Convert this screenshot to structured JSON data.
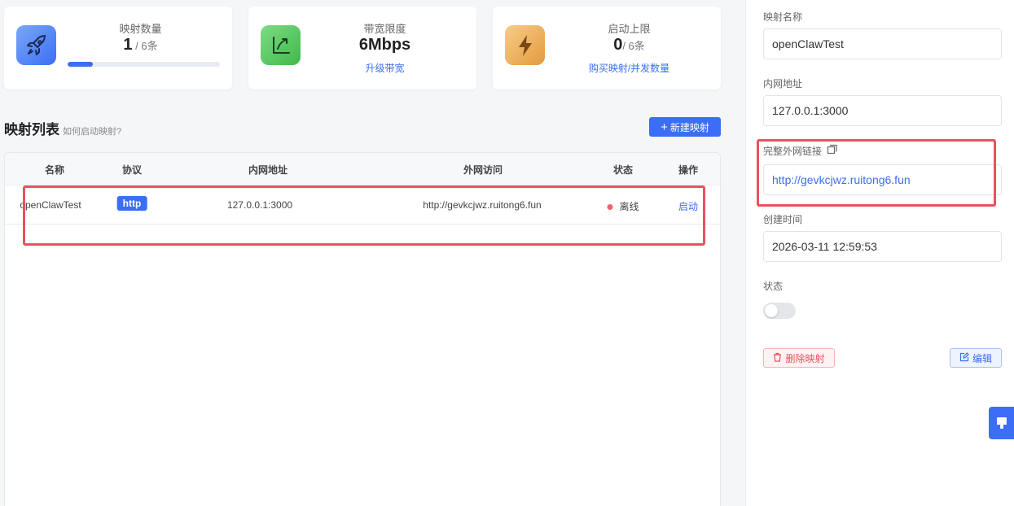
{
  "stats": {
    "mapping_count": {
      "label": "映射数量",
      "value": "1",
      "suffix": " / 6条",
      "progress": 0.167
    },
    "bandwidth": {
      "label": "带宽限度",
      "value": "6Mbps",
      "link": "升级带宽"
    },
    "start_limit": {
      "label": "启动上限",
      "value": "0",
      "suffix": "/ 6条",
      "link": "购买映射/并发数量"
    }
  },
  "list": {
    "title": "映射列表",
    "subtitle": "如何启动映射?",
    "new_button": "新建映射",
    "columns": [
      "名称",
      "协议",
      "内网地址",
      "外网访问",
      "状态",
      "操作"
    ],
    "rows": [
      {
        "name": "openClawTest",
        "protocol": "http",
        "internal": "127.0.0.1:3000",
        "external": "http://gevkcjwz.ruitong6.fun",
        "status": "离线",
        "action": "启动"
      }
    ]
  },
  "detail": {
    "name_label": "映射名称",
    "name_value": "openClawTest",
    "internal_label": "内网地址",
    "internal_value": "127.0.0.1:3000",
    "link_label": "完整外网链接",
    "link_value": "http://gevkcjwz.ruitong6.fun",
    "created_label": "创建时间",
    "created_value": "2026-03-11 12:59:53",
    "status_label": "状态",
    "status_on": false,
    "delete_button": "删除映射",
    "edit_button": "编辑"
  },
  "colors": {
    "accent": "#3b6ef5",
    "danger": "#e8525f",
    "highlight_box": "#e8525f"
  }
}
